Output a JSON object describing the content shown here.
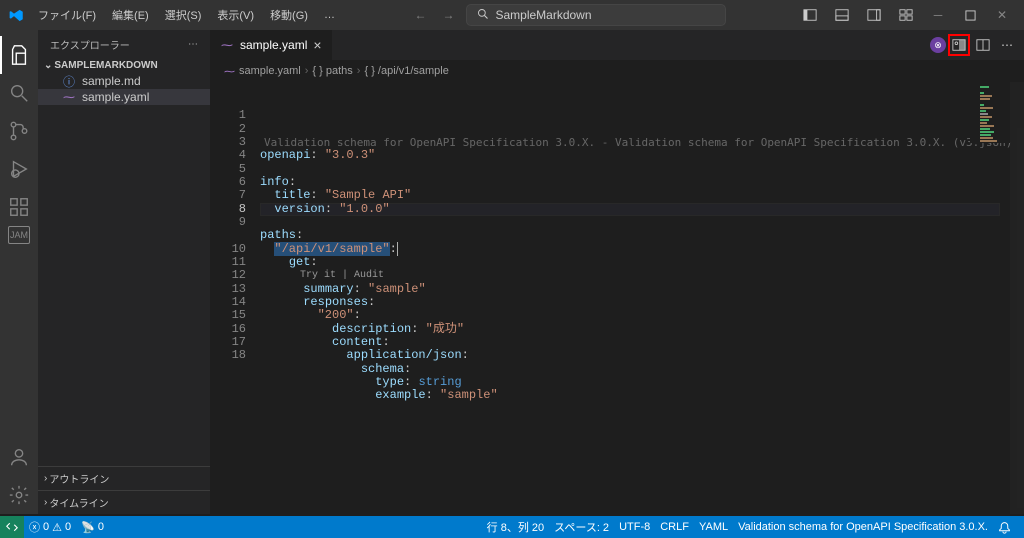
{
  "titlebar": {
    "menus": [
      "ファイル(F)",
      "編集(E)",
      "選択(S)",
      "表示(V)",
      "移動(G)",
      "…"
    ],
    "search_text": "SampleMarkdown"
  },
  "sidebar": {
    "title": "エクスプローラー",
    "section": "SAMPLEMARKDOWN",
    "files": [
      {
        "name": "sample.md",
        "icon": "info-icon"
      },
      {
        "name": "sample.yaml",
        "icon": "yaml-icon"
      }
    ],
    "collapsed": [
      "アウトライン",
      "タイムライン"
    ]
  },
  "tabs": {
    "active_file": "sample.yaml"
  },
  "breadcrumb": {
    "segments": [
      "sample.yaml",
      "{ } paths",
      "{ } /api/v1/sample"
    ]
  },
  "editor": {
    "validation_hint": "Validation schema for OpenAPI Specification 3.0.X. - Validation schema for OpenAPI Specification 3.0.X. (v3.json)",
    "code_lens": "Try it | Audit",
    "lines": [
      {
        "n": 1,
        "tokens": [
          [
            "kw",
            "openapi"
          ],
          [
            "p",
            ": "
          ],
          [
            "s",
            "\"3.0.3\""
          ]
        ]
      },
      {
        "n": 2,
        "tokens": []
      },
      {
        "n": 3,
        "tokens": [
          [
            "kw",
            "info"
          ],
          [
            "p",
            ":"
          ]
        ]
      },
      {
        "n": 4,
        "tokens": [
          [
            "p",
            "  "
          ],
          [
            "kw",
            "title"
          ],
          [
            "p",
            ": "
          ],
          [
            "s",
            "\"Sample API\""
          ]
        ]
      },
      {
        "n": 5,
        "tokens": [
          [
            "p",
            "  "
          ],
          [
            "kw",
            "version"
          ],
          [
            "p",
            ": "
          ],
          [
            "s",
            "\"1.0.0\""
          ]
        ]
      },
      {
        "n": 6,
        "tokens": []
      },
      {
        "n": 7,
        "tokens": [
          [
            "kw",
            "paths"
          ],
          [
            "p",
            ":"
          ]
        ]
      },
      {
        "n": 8,
        "tokens": [
          [
            "p",
            "  "
          ],
          [
            "s",
            "\"/api/v1/sample\""
          ],
          [
            "p",
            ":"
          ]
        ],
        "selected": true,
        "cursor": true
      },
      {
        "n": 9,
        "tokens": [
          [
            "p",
            "    "
          ],
          [
            "kw",
            "get"
          ],
          [
            "p",
            ":"
          ]
        ]
      },
      {
        "n": "lens",
        "lens": true
      },
      {
        "n": 10,
        "tokens": [
          [
            "p",
            "      "
          ],
          [
            "kw",
            "summary"
          ],
          [
            "p",
            ": "
          ],
          [
            "s",
            "\"sample\""
          ]
        ]
      },
      {
        "n": 11,
        "tokens": [
          [
            "p",
            "      "
          ],
          [
            "kw",
            "responses"
          ],
          [
            "p",
            ":"
          ]
        ]
      },
      {
        "n": 12,
        "tokens": [
          [
            "p",
            "        "
          ],
          [
            "s",
            "\"200\""
          ],
          [
            "p",
            ":"
          ]
        ]
      },
      {
        "n": 13,
        "tokens": [
          [
            "p",
            "          "
          ],
          [
            "kw",
            "description"
          ],
          [
            "p",
            ": "
          ],
          [
            "s",
            "\"成功\""
          ]
        ]
      },
      {
        "n": 14,
        "tokens": [
          [
            "p",
            "          "
          ],
          [
            "kw",
            "content"
          ],
          [
            "p",
            ":"
          ]
        ]
      },
      {
        "n": 15,
        "tokens": [
          [
            "p",
            "            "
          ],
          [
            "kw",
            "application/json"
          ],
          [
            "p",
            ":"
          ]
        ]
      },
      {
        "n": 16,
        "tokens": [
          [
            "p",
            "              "
          ],
          [
            "kw",
            "schema"
          ],
          [
            "p",
            ":"
          ]
        ]
      },
      {
        "n": 17,
        "tokens": [
          [
            "p",
            "                "
          ],
          [
            "kw",
            "type"
          ],
          [
            "p",
            ": "
          ],
          [
            "k",
            "string"
          ]
        ]
      },
      {
        "n": 18,
        "tokens": [
          [
            "p",
            "                "
          ],
          [
            "kw",
            "example"
          ],
          [
            "p",
            ": "
          ],
          [
            "s",
            "\"sample\""
          ]
        ]
      }
    ]
  },
  "statusbar": {
    "errors": "0",
    "warnings": "0",
    "ports": "0",
    "cursor": "行 8、列 20",
    "spaces": "スペース: 2",
    "encoding": "UTF-8",
    "eol": "CRLF",
    "lang": "YAML",
    "schema": "Validation schema for OpenAPI Specification 3.0.X."
  }
}
